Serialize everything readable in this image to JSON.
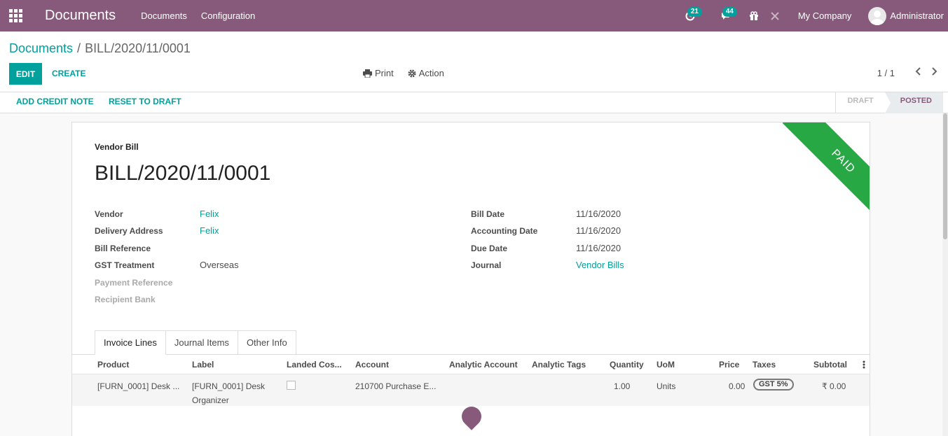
{
  "navbar": {
    "brand": "Documents",
    "menu": [
      "Documents",
      "Configuration"
    ],
    "activity_count": "21",
    "message_count": "44",
    "company": "My Company",
    "user": "Administrator"
  },
  "control": {
    "breadcrumb_parent": "Documents",
    "breadcrumb_sep": "/",
    "breadcrumb_current": "BILL/2020/11/0001",
    "edit_label": "EDIT",
    "create_label": "CREATE",
    "print_label": "Print",
    "action_label": "Action",
    "pager": "1 / 1"
  },
  "statusbar": {
    "add_credit_note": "ADD CREDIT NOTE",
    "reset_to_draft": "RESET TO DRAFT",
    "stage_draft": "DRAFT",
    "stage_posted": "POSTED"
  },
  "sheet": {
    "ribbon": "PAID",
    "doc_type": "Vendor Bill",
    "doc_name": "BILL/2020/11/0001",
    "left_fields": {
      "vendor_label": "Vendor",
      "vendor_value": "Felix",
      "delivery_label": "Delivery Address",
      "delivery_value": "Felix",
      "bill_ref_label": "Bill Reference",
      "gst_label": "GST Treatment",
      "gst_value": "Overseas",
      "payment_ref_label": "Payment Reference",
      "recipient_bank_label": "Recipient Bank"
    },
    "right_fields": {
      "bill_date_label": "Bill Date",
      "bill_date_value": "11/16/2020",
      "acc_date_label": "Accounting Date",
      "acc_date_value": "11/16/2020",
      "due_date_label": "Due Date",
      "due_date_value": "11/16/2020",
      "journal_label": "Journal",
      "journal_value": "Vendor Bills"
    },
    "tabs": [
      "Invoice Lines",
      "Journal Items",
      "Other Info"
    ],
    "columns": {
      "product": "Product",
      "label": "Label",
      "landed": "Landed Cos...",
      "account": "Account",
      "analytic_account": "Analytic Account",
      "analytic_tags": "Analytic Tags",
      "quantity": "Quantity",
      "uom": "UoM",
      "price": "Price",
      "taxes": "Taxes",
      "subtotal": "Subtotal"
    },
    "row": {
      "product": "[FURN_0001] Desk ...",
      "label_line1": "[FURN_0001] Desk",
      "label_line2": "Organizer",
      "account": "210700 Purchase E...",
      "quantity": "1.00",
      "uom": "Units",
      "price": "0.00",
      "tax": "GST 5%",
      "subtotal": "₹ 0.00"
    }
  }
}
